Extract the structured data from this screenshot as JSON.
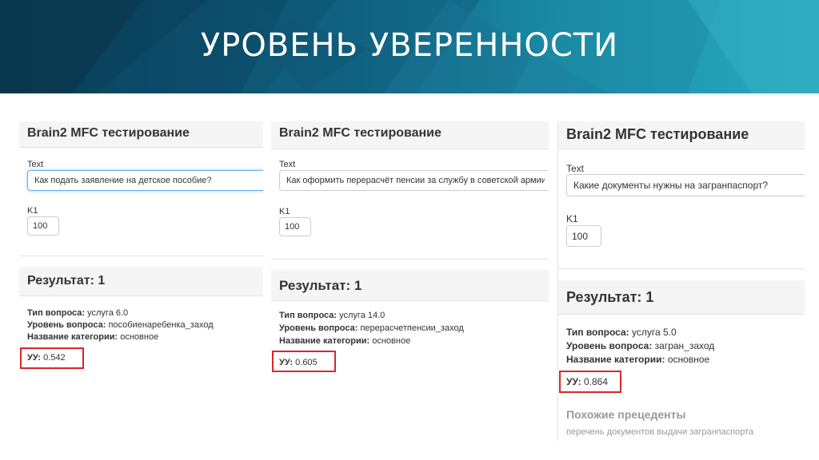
{
  "slide": {
    "title": "УРОВЕНЬ УВЕРЕННОСТИ"
  },
  "panels": [
    {
      "app_title": "Brain2 MFC тестирование",
      "text_label": "Text",
      "text_value": "Как подать заявление на детское пособие?",
      "k1_label": "K1",
      "k1_value": "100",
      "result_title": "Результат: 1",
      "type_label": "Тип вопроса:",
      "type_value": "услуга 6.0",
      "level_label": "Уровень вопроса:",
      "level_value": "пособиенаребенка_заход",
      "category_label": "Название категории:",
      "category_value": "основное",
      "confidence_label": "УУ:",
      "confidence_value": "0.542"
    },
    {
      "app_title": "Brain2 MFC тестирование",
      "text_label": "Text",
      "text_value": "Как оформить перерасчёт пенсии за службу в советской армии",
      "k1_label": "K1",
      "k1_value": "100",
      "result_title": "Результат: 1",
      "type_label": "Тип вопроса:",
      "type_value": "услуга 14.0",
      "level_label": "Уровень вопроса:",
      "level_value": "перерасчетпенсии_заход",
      "category_label": "Название категории:",
      "category_value": "основное",
      "confidence_label": "УУ:",
      "confidence_value": "0.605"
    },
    {
      "app_title": "Brain2 MFC тестирование",
      "text_label": "Text",
      "text_value": "Какие документы нужны на загранпаспорт?",
      "k1_label": "K1",
      "k1_value": "100",
      "result_title": "Результат: 1",
      "type_label": "Тип вопроса:",
      "type_value": "услуга 5.0",
      "level_label": "Уровень вопроса:",
      "level_value": "загран_заход",
      "category_label": "Название категории:",
      "category_value": "основное",
      "confidence_label": "УУ:",
      "confidence_value": "0.864",
      "similar_title": "Похожие прецеденты",
      "similar_item": "перечень документов выдачи загранпаспорта"
    }
  ],
  "colors": {
    "highlight_box": "#d9262b",
    "input_focus": "#66afe9"
  }
}
